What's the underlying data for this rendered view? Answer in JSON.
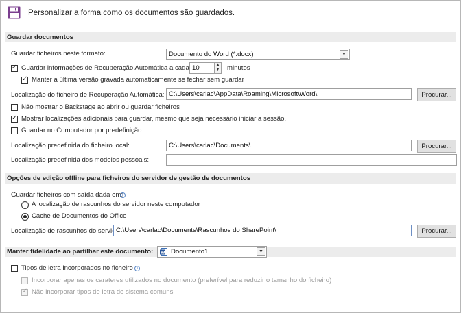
{
  "header": {
    "title": "Personalizar a forma como os documentos são guardados."
  },
  "save": {
    "section_title": "Guardar documentos",
    "format_label": "Guardar ficheiros neste formato:",
    "format_value": "Documento do Word (*.docx)",
    "autorecover_label": "Guardar informações de Recuperação Automática a cada",
    "autorecover_checked": true,
    "autorecover_minutes": "10",
    "minutes_label": "minutos",
    "keep_last_label": "Manter a última versão gravada automaticamente se fechar sem guardar",
    "keep_last_checked": true,
    "autorecover_location_label": "Localização do ficheiro de Recuperação Automática:",
    "autorecover_location_value": "C:\\Users\\carlac\\AppData\\Roaming\\Microsoft\\Word\\",
    "browse_label": "Procurar...",
    "no_backstage_label": "Não mostrar o Backstage ao abrir ou guardar ficheiros",
    "show_locations_label": "Mostrar localizações adicionais para guardar, mesmo que seja necessário iniciar a sessão.",
    "save_to_computer_label": "Guardar no Computador por predefinição",
    "default_local_label": "Localização predefinida do ficheiro local:",
    "default_local_value": "C:\\Users\\carlac\\Documents\\",
    "templates_label": "Localização predefinida dos modelos pessoais:",
    "templates_value": ""
  },
  "offline": {
    "section_title": "Opções de edição offline para ficheiros do servidor de gestão de documentos",
    "checked_out_label": "Guardar ficheiros com saída dada em:",
    "radio_server_label": "A localização de rascunhos do servidor neste computador",
    "radio_cache_label": "Cache de Documentos do Office",
    "selected_radio": "cache",
    "drafts_label": "Localização de rascunhos do servidor:",
    "drafts_value": "C:\\Users\\carlac\\Documents\\Rascunhos do SharePoint\\",
    "browse_label": "Procurar..."
  },
  "fidelity": {
    "section_title": "Manter fidelidade ao partilhar este documento:",
    "document_value": "Documento1",
    "embed_fonts_label": "Tipos de letra incorporados no ficheiro",
    "embed_used_label": "Incorporar apenas os carateres utilizados no documento (preferível para reduzir o tamanho do ficheiro)",
    "no_system_fonts_label": "Não incorporar tipos de letra de sistema comuns"
  },
  "icons": {
    "header": "save-floppy-icon",
    "doc": "word-document-icon",
    "info": "info-icon"
  },
  "colors": {
    "section_bg": "#ececec",
    "floppy": "#7b3f8f"
  }
}
